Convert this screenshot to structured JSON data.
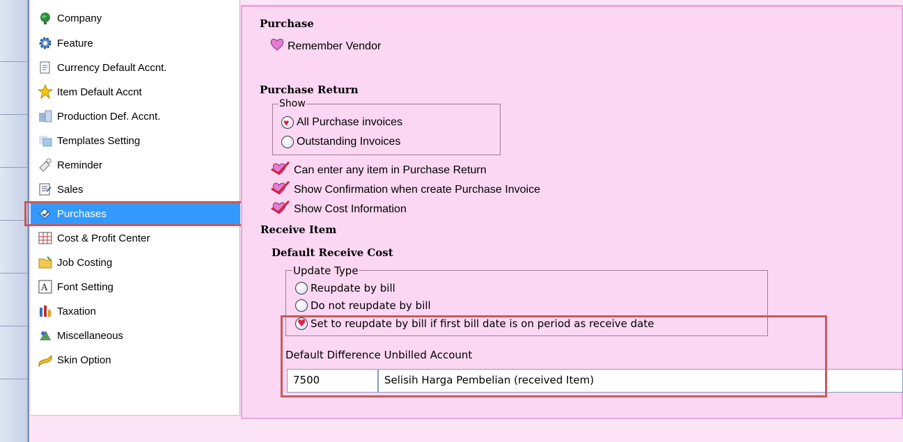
{
  "sidebar": {
    "items": [
      {
        "label": "Company",
        "icon": "globe-icon"
      },
      {
        "label": "Feature",
        "icon": "gear-icon"
      },
      {
        "label": "Currency Default Accnt.",
        "icon": "document-icon"
      },
      {
        "label": "Item Default Accnt",
        "icon": "star-icon"
      },
      {
        "label": "Production Def. Accnt.",
        "icon": "production-icon"
      },
      {
        "label": "Templates Setting",
        "icon": "templates-icon"
      },
      {
        "label": "Reminder",
        "icon": "reminder-icon"
      },
      {
        "label": "Sales",
        "icon": "sales-icon"
      },
      {
        "label": "Purchases",
        "icon": "purchases-icon",
        "selected": true
      },
      {
        "label": "Cost & Profit Center",
        "icon": "grid-icon"
      },
      {
        "label": "Job Costing",
        "icon": "folder-icon"
      },
      {
        "label": "Font Setting",
        "icon": "font-icon"
      },
      {
        "label": "Taxation",
        "icon": "taxation-icon"
      },
      {
        "label": "Miscellaneous",
        "icon": "miscellaneous-icon"
      },
      {
        "label": "Skin Option",
        "icon": "skin-icon"
      }
    ]
  },
  "purchase": {
    "title": "Purchase",
    "remember_vendor": "Remember Vendor"
  },
  "purchase_return": {
    "title": "Purchase Return",
    "show_legend": "Show",
    "options": [
      {
        "label": "All Purchase invoices",
        "checked": true
      },
      {
        "label": "Outstanding Invoices",
        "checked": false
      }
    ],
    "checks": [
      "Can enter any item in Purchase Return",
      "Show Confirmation when create Purchase Invoice",
      "Show Cost Information"
    ]
  },
  "receive_item": {
    "title": "Receive Item",
    "default_receive_cost": "Default Receive Cost",
    "update_type_legend": "Update Type",
    "options": [
      {
        "label": "Reupdate by bill",
        "checked": false
      },
      {
        "label": "Do not reupdate by bill",
        "checked": false
      },
      {
        "label": "Set to reupdate by bill if first bill date is on period as receive date",
        "checked": true
      }
    ],
    "unbilled_label": "Default Difference Unbilled Account",
    "account_code": "7500",
    "account_name": "Selisih Harga Pembelian (received Item)"
  },
  "colors": {
    "panel_bg": "#fbd7f3",
    "selection": "#3399ff",
    "highlight_border": "#c55a5a"
  }
}
